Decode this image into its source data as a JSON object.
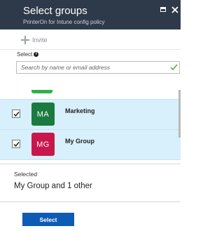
{
  "header": {
    "title": "Select groups",
    "subtitle": "PrinterOn for Intune config policy",
    "background_color": "#2e3a4a"
  },
  "toolbar": {
    "invite_label": "Invite",
    "invite_icon": "plus-icon"
  },
  "search": {
    "label": "Select",
    "label_icon": "info-icon",
    "placeholder": "Search by name or email address",
    "value": "",
    "valid_icon": "check-icon"
  },
  "groups": [
    {
      "initials": "MA",
      "name": "Marketing",
      "checked": true,
      "tile_color": "#1b7a3f"
    },
    {
      "initials": "MG",
      "name": "My Group",
      "checked": true,
      "tile_color": "#c8174c"
    }
  ],
  "partial_group": {
    "tile_color": "#2fb14a"
  },
  "selected": {
    "label": "Selected",
    "value": "My Group and 1 other"
  },
  "footer": {
    "select_button_label": "Select",
    "accent_color": "#0d5bb5"
  }
}
